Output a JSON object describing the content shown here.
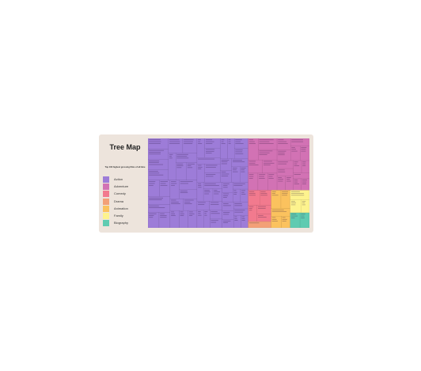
{
  "chart_data": {
    "type": "treemap",
    "title": "Tree Map",
    "subtitle": "Top 100 highest grossing films of all time",
    "legend_position": "left",
    "categories": [
      {
        "name": "Action",
        "color": "#9d7cd8",
        "films": 62
      },
      {
        "name": "Adventure",
        "color": "#d272b4",
        "films": 22
      },
      {
        "name": "Comedy",
        "color": "#f27a8e",
        "films": 5
      },
      {
        "name": "Drama",
        "color": "#f3a077",
        "films": 1
      },
      {
        "name": "Animation",
        "color": "#fbc25e",
        "films": 5
      },
      {
        "name": "Family",
        "color": "#fdf38e",
        "films": 3
      },
      {
        "name": "Biography",
        "color": "#5fcbb1",
        "films": 2
      }
    ]
  }
}
